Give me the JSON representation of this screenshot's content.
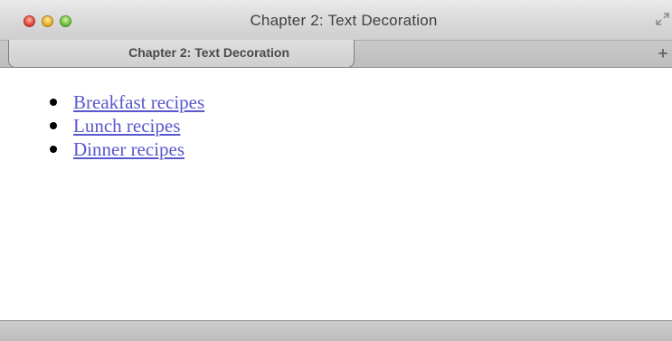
{
  "window": {
    "title": "Chapter 2: Text Decoration",
    "controls": [
      "close-button",
      "minimize-button",
      "zoom-button"
    ]
  },
  "tabs": [
    {
      "label": "Chapter 2: Text Decoration",
      "active": true
    }
  ],
  "new_tab": {
    "icon": "plus-icon",
    "label": "+"
  },
  "page": {
    "links": [
      {
        "label": "Breakfast recipes"
      },
      {
        "label": "Lunch recipes"
      },
      {
        "label": "Dinner recipes"
      }
    ]
  },
  "colors": {
    "link": "#5a57cc",
    "close": "#e5473b",
    "minimize": "#e9b12b",
    "zoom": "#6fc13a"
  }
}
